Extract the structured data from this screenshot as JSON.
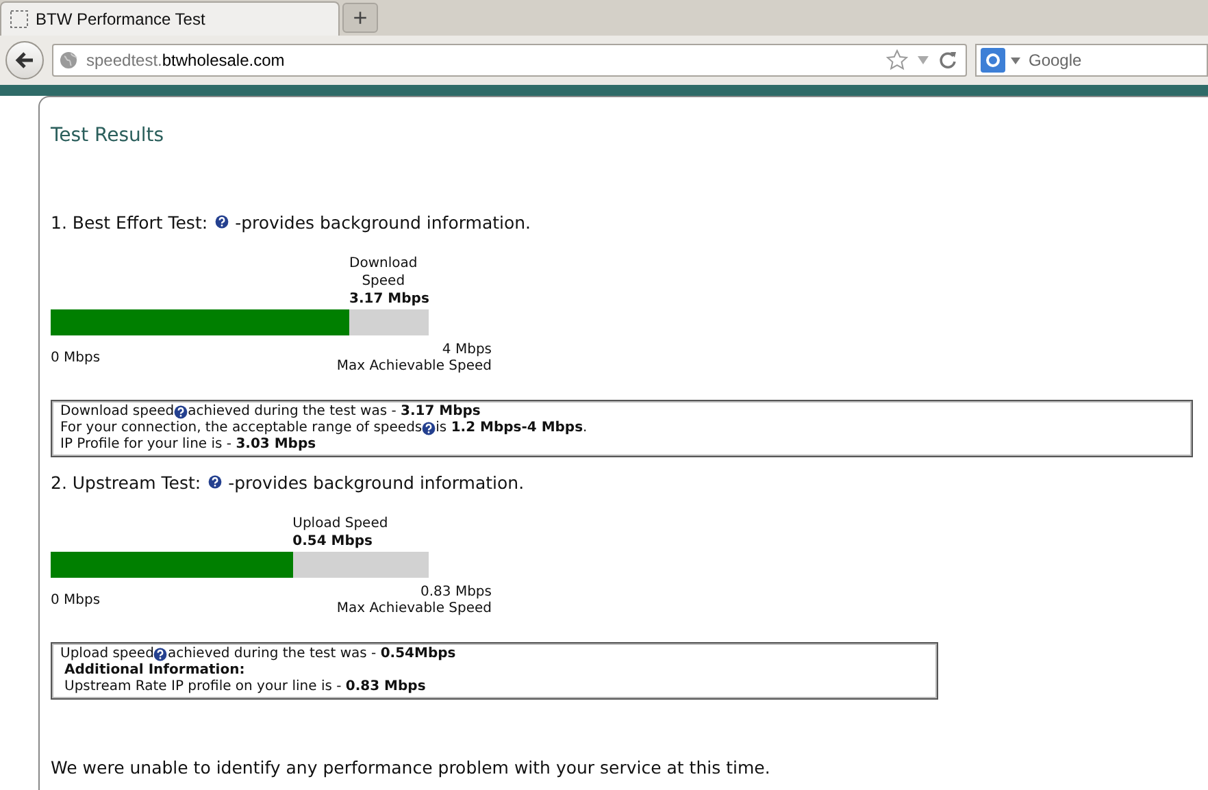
{
  "browser": {
    "tab_title": "BTW Performance Test",
    "new_tab": "+",
    "url": {
      "subdomain": "speedtest.",
      "domain": "btwholesale.com"
    },
    "search": {
      "placeholder": "Google"
    }
  },
  "page": {
    "title": "Test Results",
    "tests": [
      {
        "heading_before": "1. Best Effort Test:",
        "heading_after": "-provides background information.",
        "meter_label": [
          "Download",
          "Speed"
        ],
        "reading": "3.17 Mbps",
        "level": 0.79,
        "min_label": "0 Mbps",
        "max_label": "4 Mbps",
        "max_caption": "Max Achievable Speed",
        "info": [
          {
            "kind": "help",
            "before": "Download speed",
            "after": "achieved during the test was - **3.17 Mbps**"
          },
          {
            "kind": "help",
            "before": "For your connection, the acceptable range of speeds",
            "after": " is **1.2 Mbps-4 Mbps**."
          },
          {
            "kind": "plain",
            "text": "IP Profile for your line is - **3.03 Mbps**"
          }
        ]
      },
      {
        "heading_before": "2. Upstream Test:",
        "heading_after": "-provides background information.",
        "meter_label": [
          "Upload Speed"
        ],
        "reading": "0.54 Mbps",
        "level": 0.64,
        "min_label": "0 Mbps",
        "max_label": "0.83 Mbps",
        "max_caption": "Max Achievable Speed",
        "info": [
          {
            "kind": "help",
            "before": "Upload speed",
            "after": " achieved during the test was - **0.54Mbps**"
          },
          {
            "kind": "heading",
            "text": "Additional Information:"
          },
          {
            "kind": "plain",
            "text": "Upstream Rate IP profile on your line is - **0.83 Mbps**"
          }
        ]
      }
    ],
    "message": "We were unable to identify any performance problem with your service at this time."
  }
}
